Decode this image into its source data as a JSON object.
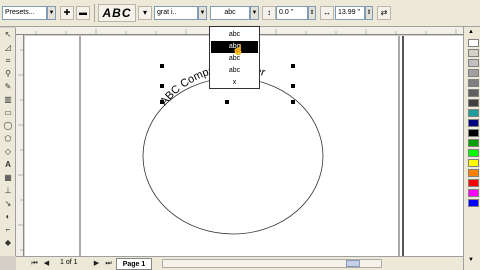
{
  "propbar": {
    "presets_value": "Presets...",
    "font_value": "grat i..",
    "style_value": "abc",
    "offset_value": "0.0 \"",
    "distance_value": "13.99 \""
  },
  "text_sample": "ABC",
  "canvas": {
    "curved_text": "ABC Computer Center"
  },
  "dropdown": {
    "items": [
      "abc",
      "abc",
      "abc",
      "abc",
      "x"
    ]
  },
  "navbar": {
    "page_count": "1 of 1",
    "page_tab": "Page 1"
  },
  "palette": {
    "colors": [
      "#ffffff",
      "#d4d0c8",
      "#c0c0c0",
      "#a0a0a0",
      "#808080",
      "#606060",
      "#404040",
      "#1e9d9d",
      "#000080",
      "#000000",
      "#00a000",
      "#00ff00",
      "#ffff00",
      "#ff8000",
      "#ff0000",
      "#ff00ff",
      "#0000ff"
    ]
  }
}
